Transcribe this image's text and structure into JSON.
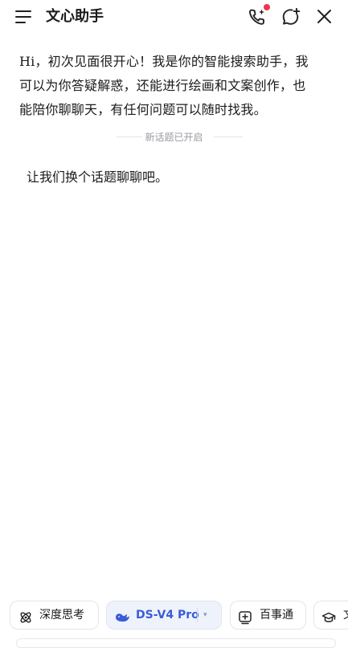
{
  "header": {
    "title": "文心助手",
    "menu_icon": "menu-icon",
    "voice_call_icon": "voice-call-sparkle-icon",
    "new_chat_icon": "new-chat-icon",
    "close_icon": "close-icon",
    "notification_dot_color": "#f0344d"
  },
  "chat": {
    "greeting_line1": "Hi，初次见面很开心！我是你的智能搜索助手，我",
    "greeting_line2": "可以为你答疑解惑，还能进行绘画和文案创作，也",
    "greeting_line3": "能陪你聊聊天，有任何问题可以随时找我。",
    "divider_text": "新话题已开启",
    "user_message": "让我们换个话题聊聊吧。"
  },
  "toolbar": {
    "deep_think_label": "深度思考",
    "deep_think_icon": "atom-icon",
    "model_label": "DS-V4 Pro",
    "model_icon": "whale-icon",
    "model_caret": "▾",
    "baishitong_label": "百事通",
    "baishitong_icon": "plus-box-icon",
    "partial_chip_label": "文",
    "partial_chip_icon": "graduation-cap-icon",
    "accent_color": "#3b5cd9"
  }
}
